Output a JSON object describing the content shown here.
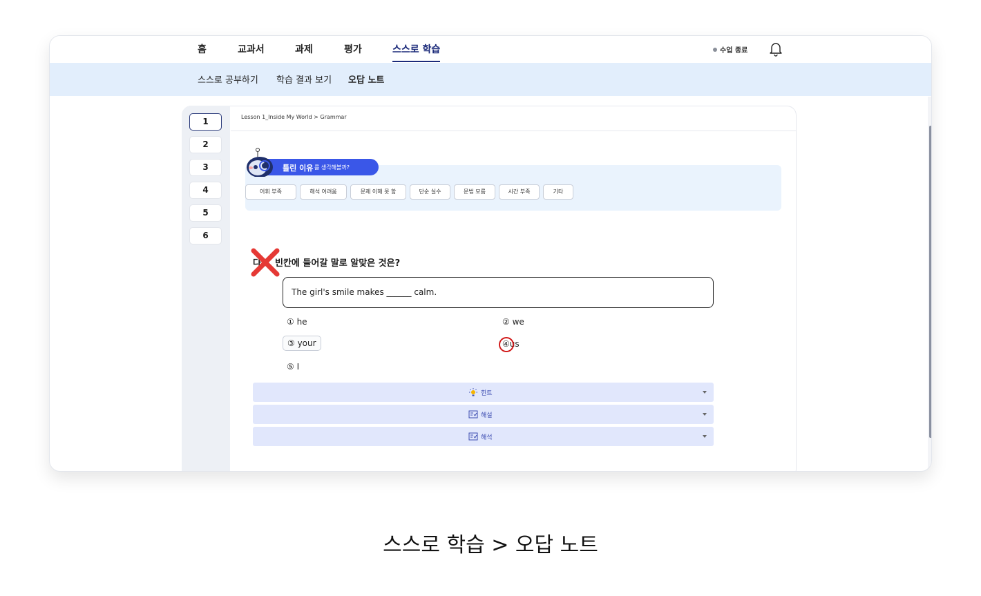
{
  "nav": {
    "home": "홈",
    "textbook": "교과서",
    "assignment": "과제",
    "evaluation": "평가",
    "self_study": "스스로 학습",
    "status": "수업 종료"
  },
  "subnav": {
    "study": "스스로 공부하기",
    "results": "학습 결과 보기",
    "wrong_notes": "오답 노트"
  },
  "question_numbers": [
    "1",
    "2",
    "3",
    "4",
    "5",
    "6"
  ],
  "breadcrumb": "Lesson 1_Inside My World > Grammar",
  "reason": {
    "title_bold": "틀린 이유",
    "title_light": "를 생각해볼까?",
    "chips": [
      "어휘 부족",
      "해석 어려움",
      "문제 이해 못 함",
      "단순 실수",
      "문법 모름",
      "시간 부족",
      "기타"
    ]
  },
  "question": {
    "prefix": "다",
    "text": "빈칸에 들어갈 말로 알맞은 것은?",
    "sentence": "The girl's smile makes ______ calm.",
    "options": {
      "o1": "① he",
      "o2": "② we",
      "o3": "③ your",
      "o4_num": "④",
      "o4_text": "us",
      "o5": "⑤ I"
    },
    "selected_option": "③ your",
    "correct_option": "④ us"
  },
  "accordions": {
    "hint": "힌트",
    "explanation": "해설",
    "translation": "해석"
  },
  "caption": "스스로 학습 > 오답 노트",
  "colors": {
    "accent": "#1b2a7a",
    "subnav_bg": "#e2eefc",
    "pill": "#3a57e8",
    "wrong_mark": "#e53935",
    "correct_circle": "#d11a1a",
    "accordion_bg": "#e1e7fc"
  },
  "icons": [
    "bell-icon",
    "mascot-icon",
    "wrong-x-icon",
    "bulb-icon",
    "note-icon",
    "chevron-down-icon"
  ]
}
